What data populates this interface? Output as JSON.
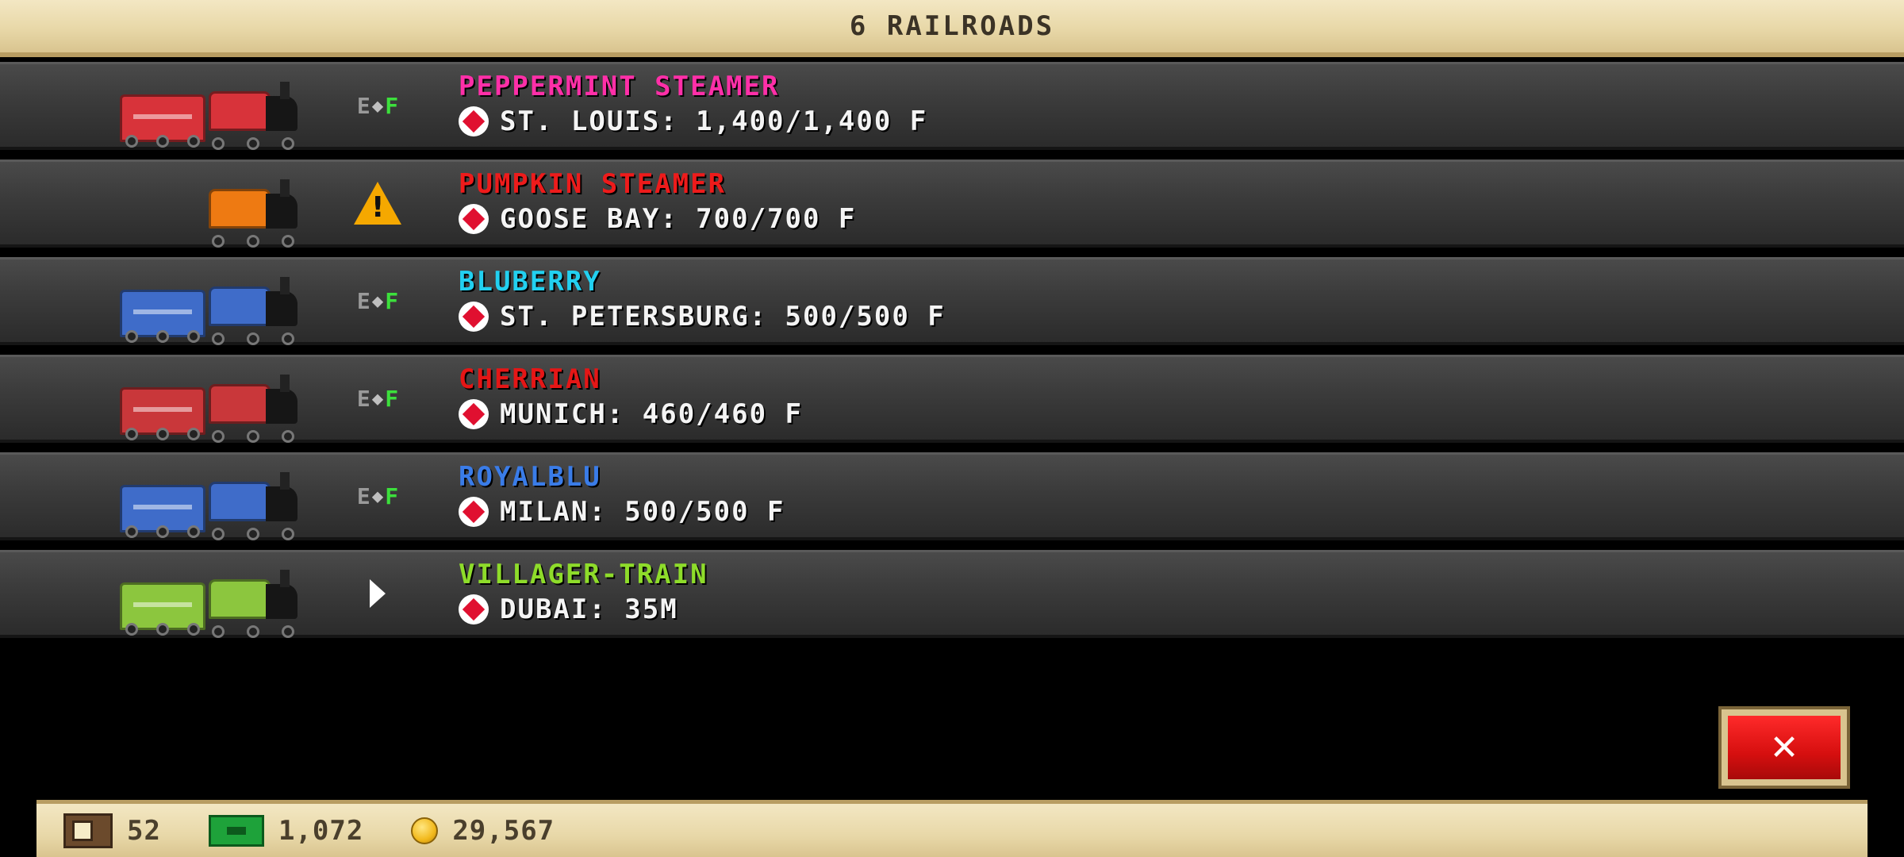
{
  "header": {
    "title": "6 RAILROADS"
  },
  "railroads": [
    {
      "name": "PEPPERMINT STEAMER",
      "name_color": "#ff2fa8",
      "destination": "ST. LOUIS: 1,400/1,400 F",
      "status_icon": "fuel-gauge-icon",
      "fuel": {
        "empty": "E",
        "full": "F"
      },
      "colors": {
        "car": "#d8333a",
        "loco": "#d8333a"
      },
      "has_car": true
    },
    {
      "name": "PUMPKIN STEAMER",
      "name_color": "#ee1b1b",
      "destination": "GOOSE BAY: 700/700 F",
      "status_icon": "warning-icon",
      "colors": {
        "loco": "#ee7a12"
      },
      "has_car": false
    },
    {
      "name": "BLUBERRY",
      "name_color": "#22d0f0",
      "destination": "ST. PETERSBURG: 500/500 F",
      "status_icon": "fuel-gauge-icon",
      "fuel": {
        "empty": "E",
        "full": "F"
      },
      "colors": {
        "car": "#3f6cc9",
        "loco": "#3f6cc9"
      },
      "has_car": true
    },
    {
      "name": "CHERRIAN",
      "name_color": "#e51616",
      "destination": "MUNICH: 460/460 F",
      "status_icon": "fuel-gauge-icon",
      "fuel": {
        "empty": "E",
        "full": "F"
      },
      "colors": {
        "car": "#c9373a",
        "loco": "#c9373a"
      },
      "has_car": true
    },
    {
      "name": "ROYALBLU",
      "name_color": "#3a7ce8",
      "destination": "MILAN: 500/500 F",
      "status_icon": "fuel-gauge-icon",
      "fuel": {
        "empty": "E",
        "full": "F"
      },
      "colors": {
        "car": "#3f6cc9",
        "loco": "#3f6cc9"
      },
      "has_car": true
    },
    {
      "name": "VILLAGER-TRAIN",
      "name_color": "#8edc2a",
      "destination": "DUBAI: 35M",
      "status_icon": "play-icon",
      "colors": {
        "car": "#8cc63e",
        "loco": "#8cc63e"
      },
      "has_car": true
    }
  ],
  "close_button": {
    "label": "✕"
  },
  "footer": {
    "crates": "52",
    "cash": "1,072",
    "coins": "29,567"
  }
}
